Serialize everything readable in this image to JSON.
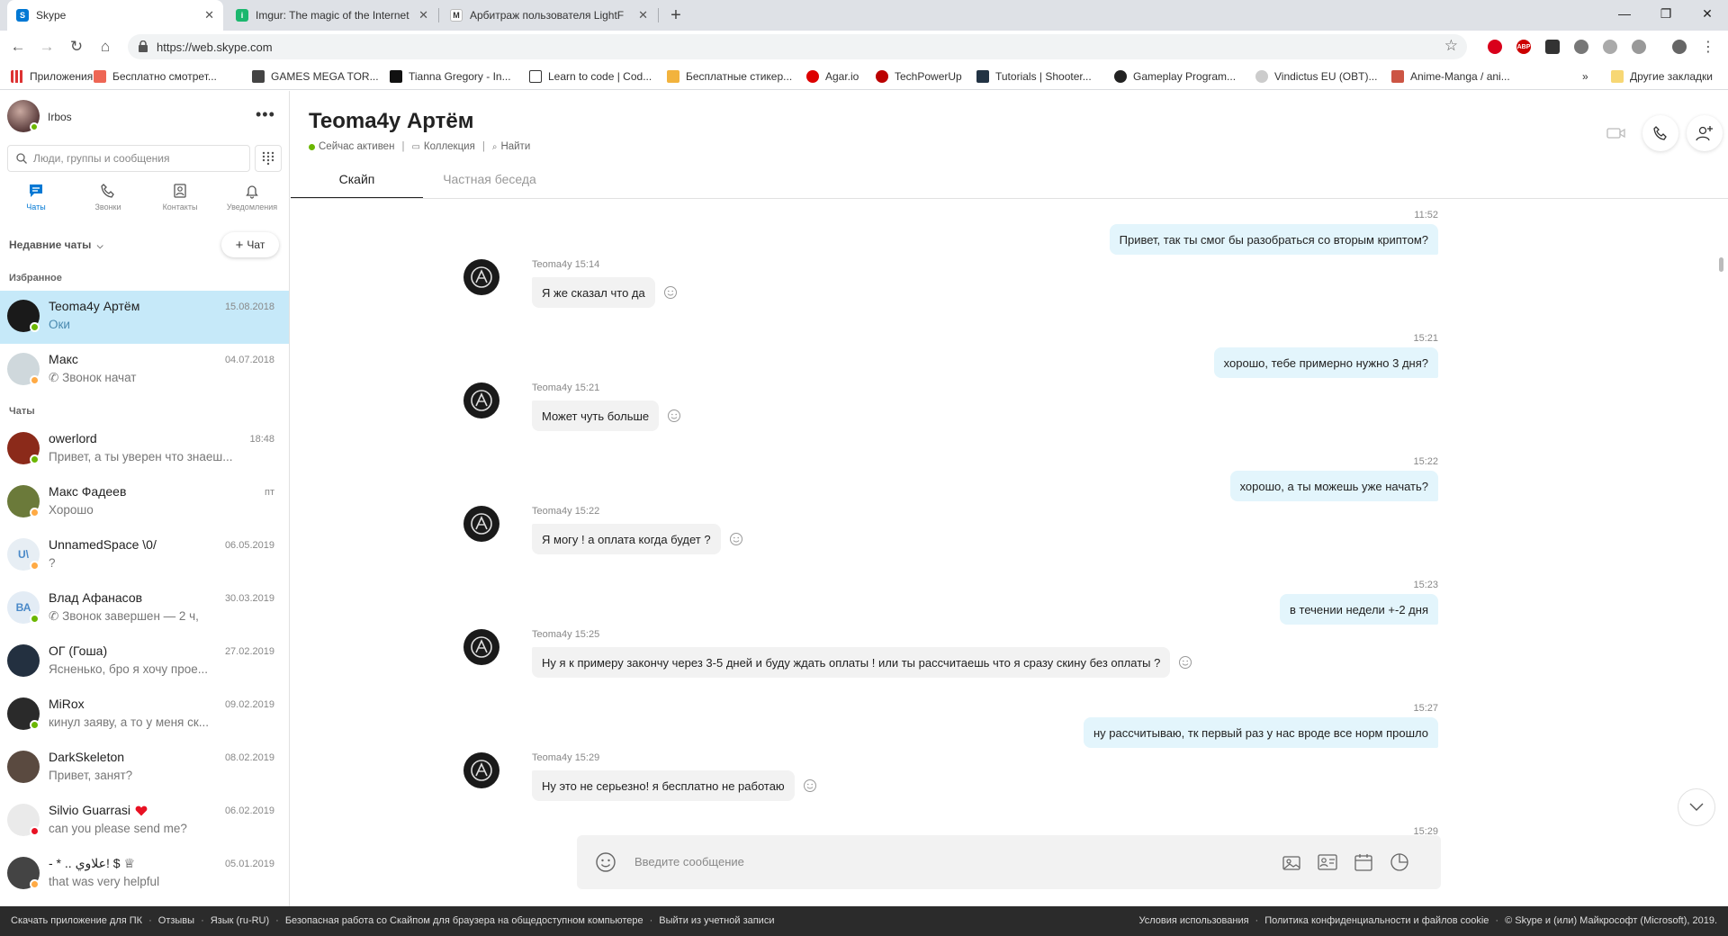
{
  "browser": {
    "tabs": [
      {
        "title": "Skype",
        "active": true
      },
      {
        "title": "Imgur: The magic of the Internet",
        "active": false
      },
      {
        "title": "Арбитраж пользователя LightF",
        "active": false
      }
    ],
    "url": "https://web.skype.com",
    "bookmarks": [
      {
        "label": "Приложения",
        "icon": "apps-grid-icon"
      },
      {
        "label": "Бесплатно смотрет...",
        "icon": "bookmark-icon"
      },
      {
        "label": "GAMES MEGA TOR...",
        "icon": "bookmark-icon"
      },
      {
        "label": "Tianna Gregory - In...",
        "icon": "bookmark-icon"
      },
      {
        "label": "Learn to code | Cod...",
        "icon": "bookmark-icon"
      },
      {
        "label": "Бесплатные стикер...",
        "icon": "bookmark-icon"
      },
      {
        "label": "Agar.io",
        "icon": "bookmark-icon"
      },
      {
        "label": "TechPowerUp",
        "icon": "bookmark-icon"
      },
      {
        "label": "Tutorials | Shooter...",
        "icon": "bookmark-icon"
      },
      {
        "label": "Gameplay Program...",
        "icon": "bookmark-icon"
      },
      {
        "label": "Vindictus EU (OBT)...",
        "icon": "bookmark-icon"
      },
      {
        "label": "Anime-Manga / ani...",
        "icon": "bookmark-icon"
      }
    ],
    "more_bookmarks": "»",
    "other_bookmarks": "Другие закладки",
    "extensions": [
      "ABP"
    ]
  },
  "sidebar": {
    "me_name": "Irbos",
    "search_placeholder": "Люди, группы и сообщения",
    "nav": [
      {
        "label": "Чаты",
        "icon": "chat-icon",
        "active": true
      },
      {
        "label": "Звонки",
        "icon": "phone-icon",
        "active": false
      },
      {
        "label": "Контакты",
        "icon": "contacts-icon",
        "active": false
      },
      {
        "label": "Уведомления",
        "icon": "bell-icon",
        "active": false
      }
    ],
    "recent_label": "Недавние чаты",
    "new_chat_label": "Чат",
    "favorites_label": "Избранное",
    "chats_label": "Чаты",
    "favorites": [
      {
        "name": "Teoma4y Артём",
        "preview": "Оки",
        "date": "15.08.2018",
        "status": "online",
        "selected": true
      },
      {
        "name": "Макс",
        "preview": "Звонок начат",
        "date": "04.07.2018",
        "status": "away",
        "selected": false
      }
    ],
    "chats": [
      {
        "name": "owerlord",
        "preview": "Привет, а ты уверен что знаеш...",
        "date": "18:48",
        "status": "online"
      },
      {
        "name": "Макс Фадеев",
        "preview": "Хорошо",
        "date": "пт",
        "status": "away"
      },
      {
        "name": "UnnamedSpace \\0/",
        "preview": "?",
        "date": "06.05.2019",
        "status": "away",
        "initials": "U\\"
      },
      {
        "name": "Влад Афанасов",
        "preview": "Звонок завершен — 2 ч,",
        "date": "30.03.2019",
        "status": "online",
        "initials": "ВА"
      },
      {
        "name": "ОГ (Гоша)",
        "preview": "Ясненько, бро я хочу прое...",
        "date": "27.02.2019",
        "status": "none"
      },
      {
        "name": "MiRox",
        "preview": "кинул заяву, а то у меня ск...",
        "date": "09.02.2019",
        "status": "online"
      },
      {
        "name": "DarkSkeleton",
        "preview": "Привет, занят?",
        "date": "08.02.2019",
        "status": "none"
      },
      {
        "name": "Silvio Guarrasi",
        "preview": "can you please send me?",
        "date": "06.02.2019",
        "status": "busy"
      },
      {
        "name": "- * .. علاوي! $ ♕",
        "preview": "that was very helpful",
        "date": "05.01.2019",
        "status": "away"
      }
    ]
  },
  "conversation": {
    "title": "Teoma4y Артём",
    "status": "Сейчас активен",
    "collection": "Коллекция",
    "find": "Найти",
    "tabs": [
      "Скайп",
      "Частная беседа"
    ],
    "composer_placeholder": "Введите сообщение",
    "messages": [
      {
        "dir": "out",
        "time": "11:52",
        "text": "Привет, так ты смог бы разобраться со вторым криптом?"
      },
      {
        "dir": "in",
        "meta": "Teoma4y 15:14",
        "text": "Я же сказал что да"
      },
      {
        "dir": "out",
        "time": "15:21",
        "text": "хорошо, тебе примерно нужно 3 дня?"
      },
      {
        "dir": "in",
        "meta": "Teoma4y 15:21",
        "text": "Может чуть больше"
      },
      {
        "dir": "out",
        "time": "15:22",
        "text": "хорошо, а ты можешь уже начать?"
      },
      {
        "dir": "in",
        "meta": "Teoma4y 15:22",
        "text": "Я могу ! а оплата когда будет ?"
      },
      {
        "dir": "out",
        "time": "15:23",
        "text": "в течении недели +-2 дня"
      },
      {
        "dir": "in",
        "meta": "Teoma4y 15:25",
        "text": "Ну я к примеру закончу через 3-5 дней и буду ждать оплаты ! или ты рассчитаешь что я сразу скину без оплаты ?"
      },
      {
        "dir": "out",
        "time": "15:27",
        "text": "ну рассчитываю, тк первый раз у нас вроде все норм прошло"
      },
      {
        "dir": "in",
        "meta": "Teoma4y 15:29",
        "text": "Ну это не серьезно! я бесплатно не работаю"
      },
      {
        "dir": "out",
        "time": "15:29",
        "text": ""
      }
    ]
  },
  "footer": {
    "left": [
      "Скачать приложение для ПК",
      "Отзывы",
      "Язык (ru-RU)",
      "Безопасная работа со Скайпом для браузера на общедоступном компьютере",
      "Выйти из учетной записи"
    ],
    "right": [
      "Условия использования",
      "Политика конфиденциальности и файлов cookie",
      "© Skype и (или) Майкрософт (Microsoft), 2019."
    ]
  },
  "colors": {
    "accent": "#0078d4",
    "selected_chat": "#c6e9f9",
    "outgoing_bubble": "#e3f5fc",
    "incoming_bubble": "#f2f2f2",
    "status_online": "#6bb700",
    "status_away": "#ffaa44",
    "status_busy": "#e81123",
    "footer_bg": "#2b2b2b"
  }
}
